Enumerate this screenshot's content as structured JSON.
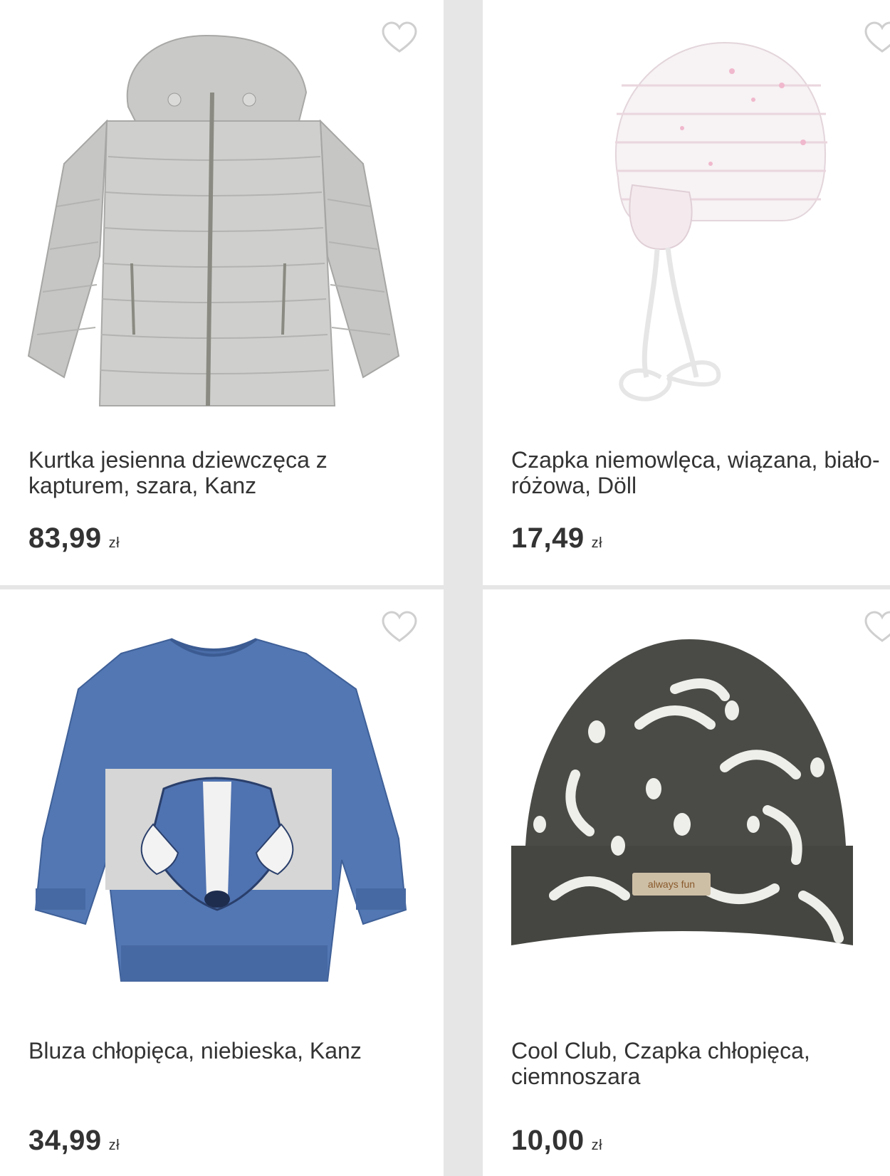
{
  "products": [
    {
      "title": "Kurtka jesienna dziewczęca z kapturem, szara, Kanz",
      "price": "83,99",
      "currency": "zł",
      "image": "gray-puffer-jacket"
    },
    {
      "title": "Czapka niemowlęca, wiązana, biało-różowa, Döll",
      "price": "17,49",
      "currency": "zł",
      "image": "white-pink-baby-hat"
    },
    {
      "title": "Bluza chłopięca, niebieska, Kanz",
      "price": "34,99",
      "currency": "zł",
      "image": "blue-badger-sweatshirt"
    },
    {
      "title": "Cool Club, Czapka chłopięca, ciemnoszara",
      "price": "10,00",
      "currency": "zł",
      "image": "dark-gray-smiley-beanie",
      "hat_label": "always fun"
    }
  ],
  "icons": {
    "favorite": "heart-outline-icon"
  },
  "colors": {
    "heart_stroke": "#cfcfcf",
    "text": "#333333",
    "divider": "#e6e6e6"
  }
}
